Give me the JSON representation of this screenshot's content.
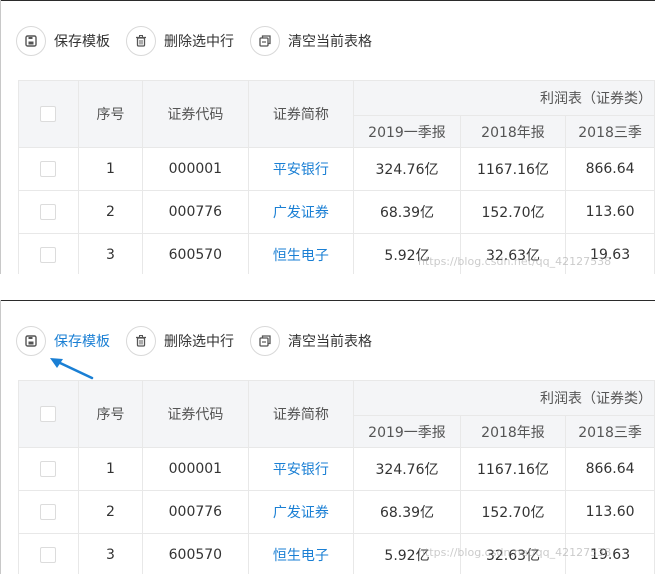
{
  "toolbar": {
    "save_label": "保存模板",
    "delete_label": "删除选中行",
    "clear_label": "清空当前表格"
  },
  "table": {
    "group_header": "利润表（证券类）",
    "headers": {
      "index": "序号",
      "code": "证券代码",
      "name": "证券简称",
      "q1_2019": "2019一季报",
      "annual_2018": "2018年报",
      "q3_2018": "2018三季"
    },
    "rows": [
      {
        "index": "1",
        "code": "000001",
        "name": "平安银行",
        "q1_2019": "324.76亿",
        "annual_2018": "1167.16亿",
        "q3_2018": "866.64"
      },
      {
        "index": "2",
        "code": "000776",
        "name": "广发证券",
        "q1_2019": "68.39亿",
        "annual_2018": "152.70亿",
        "q3_2018": "113.60"
      },
      {
        "index": "3",
        "code": "600570",
        "name": "恒生电子",
        "q1_2019": "5.92亿",
        "annual_2018": "32.63亿",
        "q3_2018": "19.63"
      }
    ]
  },
  "watermark": "https://blog.csdn.net/qq_42127538",
  "colors": {
    "accent": "#1a7fd4",
    "header_bg": "#f4f5f7",
    "border": "#e8e8e8"
  },
  "icons": {
    "save": "save-icon",
    "delete": "trash-icon",
    "clear": "clear-table-icon",
    "pointer": "arrow-pointer-icon"
  }
}
